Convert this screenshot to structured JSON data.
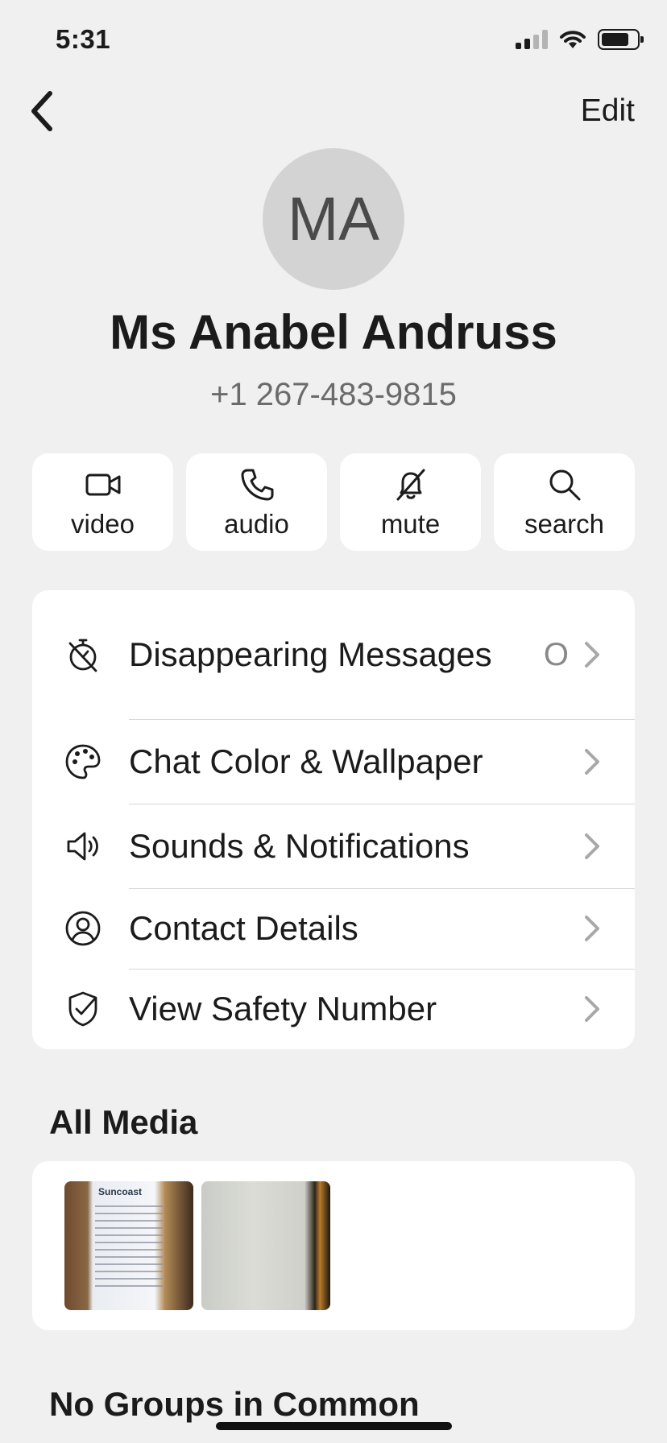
{
  "status": {
    "time": "5:31"
  },
  "nav": {
    "edit_label": "Edit"
  },
  "contact": {
    "initials": "MA",
    "name": "Ms Anabel Andruss",
    "phone": "+1 267-483-9815"
  },
  "actions": [
    {
      "label": "video",
      "icon": "video-icon"
    },
    {
      "label": "audio",
      "icon": "phone-icon"
    },
    {
      "label": "mute",
      "icon": "bell-slash-icon"
    },
    {
      "label": "search",
      "icon": "search-icon"
    }
  ],
  "settings": [
    {
      "label": "Disappearing Messages",
      "value": "O",
      "icon": "timer-off-icon"
    },
    {
      "label": "Chat Color & Wallpaper",
      "icon": "palette-icon"
    },
    {
      "label": "Sounds & Notifications",
      "icon": "speaker-icon"
    },
    {
      "label": "Contact Details",
      "icon": "person-circle-icon"
    },
    {
      "label": "View Safety Number",
      "icon": "shield-check-icon"
    }
  ],
  "media": {
    "title": "All Media",
    "thumbnail_caption": "Suncoast"
  },
  "groups": {
    "title": "No Groups in Common"
  },
  "colors": {
    "background": "#f0f0f0",
    "card": "#ffffff",
    "text": "#1b1b1b",
    "secondary": "#6b6b6b"
  }
}
